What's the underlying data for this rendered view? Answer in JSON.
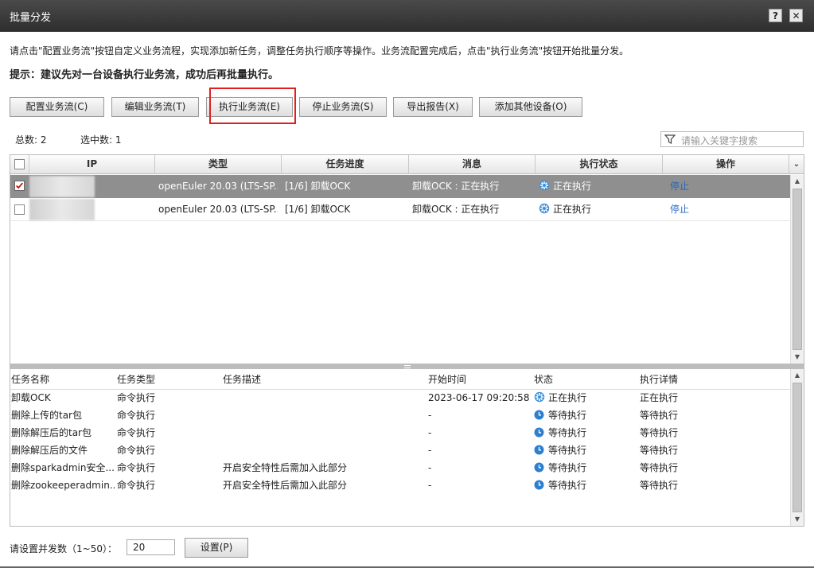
{
  "window": {
    "title": "批量分发",
    "help_label": "?",
    "close_label": "✕"
  },
  "description": "请点击\"配置业务流\"按钮自定义业务流程，实现添加新任务，调整任务执行顺序等操作。业务流配置完成后，点击\"执行业务流\"按钮开始批量分发。",
  "tip": "提示：建议先对一台设备执行业务流，成功后再批量执行。",
  "toolbar": {
    "configure": "配置业务流(C)",
    "edit": "编辑业务流(T)",
    "execute": "执行业务流(E)",
    "stop": "停止业务流(S)",
    "export": "导出报告(X)",
    "add_device": "添加其他设备(O)"
  },
  "stats": {
    "total": "总数: 2",
    "selected": "选中数: 1"
  },
  "search": {
    "placeholder": "请输入关键字搜索",
    "icon": "filter-icon"
  },
  "device_table": {
    "columns": [
      "IP",
      "类型",
      "任务进度",
      "消息",
      "执行状态",
      "操作"
    ],
    "rows": [
      {
        "checked": true,
        "type": "openEuler 20.03 (LTS-SP...",
        "progress": "[1/6] 卸载OCK",
        "message": "卸载OCK : 正在执行",
        "status": "正在执行",
        "action": "停止"
      },
      {
        "checked": false,
        "type": "openEuler 20.03 (LTS-SP...",
        "progress": "[1/6] 卸载OCK",
        "message": "卸载OCK : 正在执行",
        "status": "正在执行",
        "action": "停止"
      }
    ]
  },
  "task_table": {
    "columns": [
      "任务名称",
      "任务类型",
      "任务描述",
      "开始时间",
      "状态",
      "执行详情"
    ],
    "rows": [
      {
        "name": "卸载OCK",
        "type": "命令执行",
        "desc": "",
        "start": "2023-06-17 09:20:58",
        "status": "正在执行",
        "status_icon": "gear-icon",
        "detail": "正在执行"
      },
      {
        "name": "删除上传的tar包",
        "type": "命令执行",
        "desc": "",
        "start": "-",
        "status": "等待执行",
        "status_icon": "clock-icon",
        "detail": "等待执行"
      },
      {
        "name": "删除解压后的tar包",
        "type": "命令执行",
        "desc": "",
        "start": "-",
        "status": "等待执行",
        "status_icon": "clock-icon",
        "detail": "等待执行"
      },
      {
        "name": "删除解压后的文件",
        "type": "命令执行",
        "desc": "",
        "start": "-",
        "status": "等待执行",
        "status_icon": "clock-icon",
        "detail": "等待执行"
      },
      {
        "name": "删除sparkadmin安全...",
        "type": "命令执行",
        "desc": "开启安全特性后需加入此部分",
        "start": "-",
        "status": "等待执行",
        "status_icon": "clock-icon",
        "detail": "等待执行"
      },
      {
        "name": "删除zookeeperadmin...",
        "type": "命令执行",
        "desc": "开启安全特性后需加入此部分",
        "start": "-",
        "status": "等待执行",
        "status_icon": "clock-icon",
        "detail": "等待执行"
      }
    ]
  },
  "concurrency": {
    "label": "请设置并发数（1~50）：",
    "value": "20",
    "set_button": "设置(P)"
  },
  "colors": {
    "titlebar": "#3a3a3a",
    "selected_row": "#8f8f8f",
    "link": "#2a6ec5",
    "highlight_box": "#e02020"
  }
}
